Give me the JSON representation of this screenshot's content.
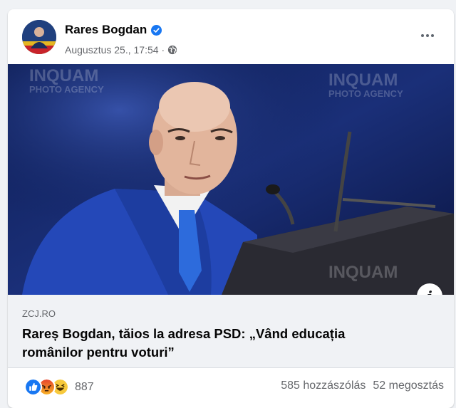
{
  "post": {
    "author": "Rares Bogdan",
    "verified_icon": "verified-badge-icon",
    "timestamp": "Augusztus 25., 17:54",
    "privacy_icon": "globe-icon",
    "more_icon": "more-options-icon",
    "image": {
      "watermark_top_left": "INQUAM\nPHOTO AGENCY",
      "watermark_top_right": "INQUAM\nPHOTO AGENCY",
      "watermark_bottom_right": "INQUAM"
    },
    "info_icon": "i",
    "link_preview": {
      "domain": "ZCJ.RO",
      "headline": "Rareș Bogdan, tăios la adresa PSD: „Vând educația românilor pentru voturi”"
    },
    "reactions": {
      "icons": [
        "like-icon",
        "angry-icon",
        "haha-icon"
      ],
      "count": "887"
    },
    "comments": "585 hozzászólás",
    "shares": "52 megosztás"
  },
  "colors": {
    "accent": "#1877f2",
    "secondary_text": "#65676b",
    "preview_bg": "#f0f2f5"
  }
}
